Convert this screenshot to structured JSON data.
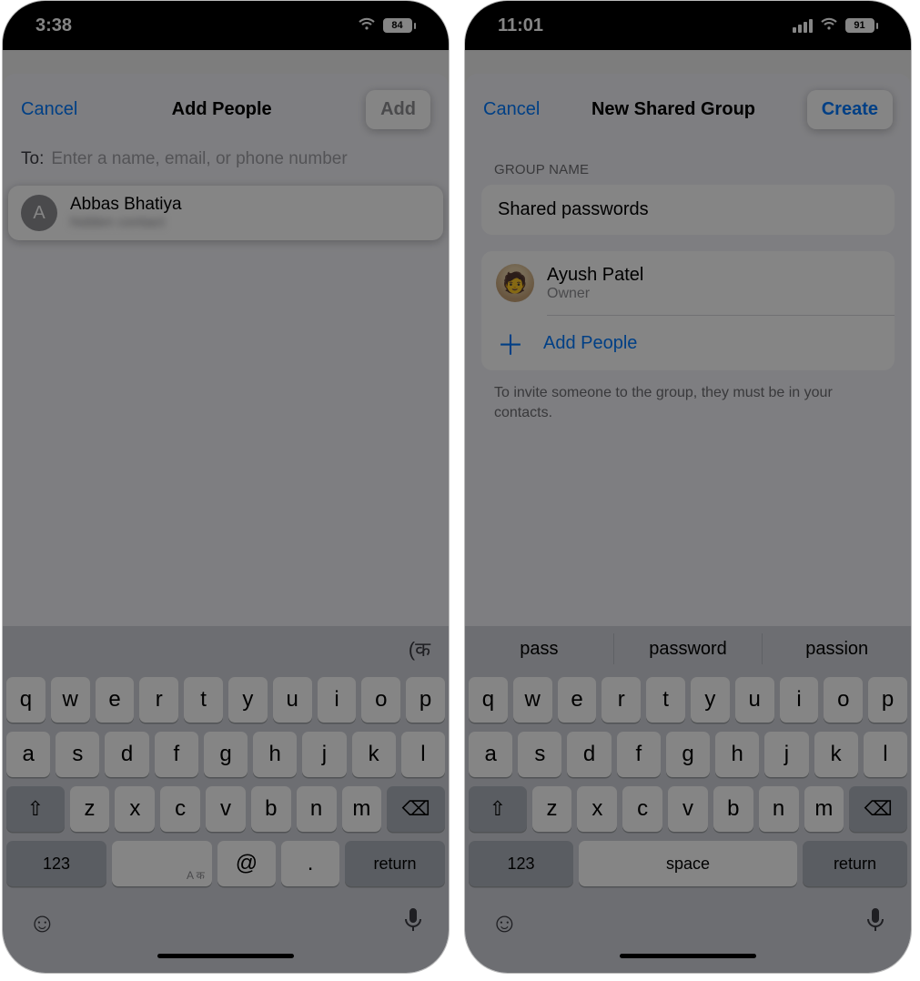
{
  "left": {
    "status": {
      "time": "3:38",
      "battery": "84"
    },
    "nav": {
      "cancel": "Cancel",
      "title": "Add People",
      "action": "Add"
    },
    "to": {
      "label": "To:",
      "placeholder": "Enter a name, email, or phone number"
    },
    "contact": {
      "initial": "A",
      "name": "Abbas Bhatiya",
      "sub": "hidden contact"
    },
    "keyboard": {
      "lang_glyph": "(क",
      "row1": [
        "q",
        "w",
        "e",
        "r",
        "t",
        "y",
        "u",
        "i",
        "o",
        "p"
      ],
      "row2": [
        "a",
        "s",
        "d",
        "f",
        "g",
        "h",
        "j",
        "k",
        "l"
      ],
      "row3": [
        "z",
        "x",
        "c",
        "v",
        "b",
        "n",
        "m"
      ],
      "num": "123",
      "lang_small": "A क",
      "at": "@",
      "dot": ".",
      "ret": "return"
    }
  },
  "right": {
    "status": {
      "time": "11:01",
      "battery": "91"
    },
    "nav": {
      "cancel": "Cancel",
      "title": "New Shared Group",
      "action": "Create"
    },
    "section_label": "GROUP NAME",
    "group_name_value": "Shared passwords",
    "owner": {
      "name": "Ayush Patel",
      "role": "Owner"
    },
    "add_people": "Add People",
    "footer": "To invite someone to the group, they must be in your contacts.",
    "suggestions": [
      "pass",
      "password",
      "passion"
    ],
    "keyboard": {
      "row1": [
        "q",
        "w",
        "e",
        "r",
        "t",
        "y",
        "u",
        "i",
        "o",
        "p"
      ],
      "row2": [
        "a",
        "s",
        "d",
        "f",
        "g",
        "h",
        "j",
        "k",
        "l"
      ],
      "row3": [
        "z",
        "x",
        "c",
        "v",
        "b",
        "n",
        "m"
      ],
      "num": "123",
      "space": "space",
      "ret": "return"
    }
  }
}
